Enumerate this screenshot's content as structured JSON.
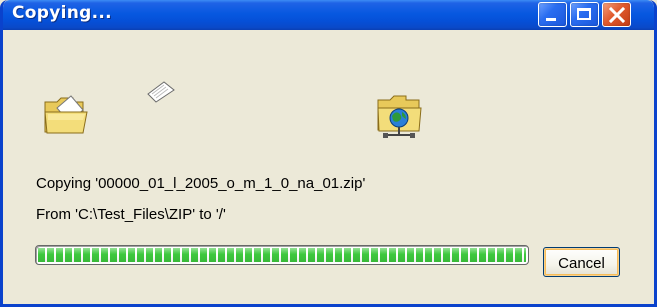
{
  "window": {
    "title": "Copying...",
    "controls": [
      "minimize",
      "maximize",
      "close"
    ]
  },
  "animation": {
    "source_icon": "folder-icon",
    "flying_icon": "paper-sheet-icon",
    "destination_icon": "network-folder-icon"
  },
  "status": {
    "line1": "Copying '00000_01_l_2005_o_m_1_0_na_01.zip'",
    "line2": "From 'C:\\Test_Files\\ZIP' to '/'"
  },
  "progress": {
    "fraction": 1.0,
    "color": "#3ec83e"
  },
  "buttons": {
    "cancel_label": "Cancel"
  },
  "colors": {
    "titlebar": "#0758e0",
    "dialog_bg": "#ece9d8",
    "close_button": "#e05a2e"
  }
}
